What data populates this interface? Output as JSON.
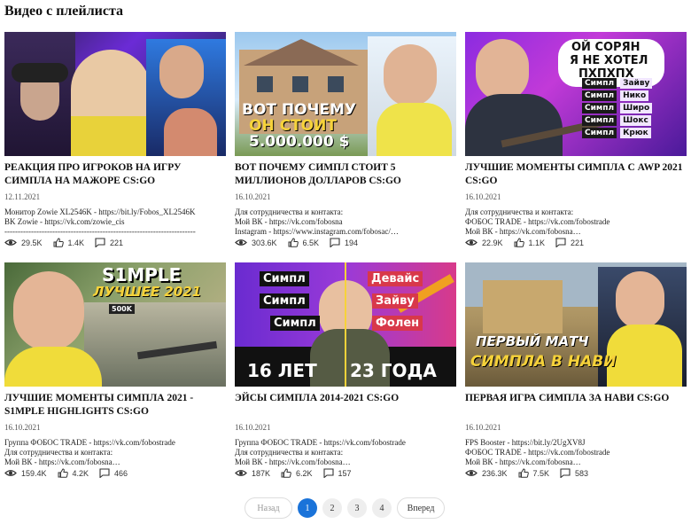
{
  "heading": "Видео с плейлиста",
  "videos": [
    {
      "title": "РЕАКЦИЯ ПРО ИГРОКОВ НА ИГРУ СИМПЛА НА МАЖОРЕ CS:GO",
      "date": "12.11.2021",
      "desc": "Монитор Zowie XL2546K - https://bit.ly/Fobos_XL2546K\nBK Zowie - https://vk.com/zowie_cis\n------------------------------------------------------------------------",
      "views": "29.5K",
      "likes": "1.4K",
      "comments": "221",
      "overlay": []
    },
    {
      "title": "ВОТ ПОЧЕМУ СИМПЛ СТОИТ 5 МИЛЛИОНОВ ДОЛЛАРОВ CS:GO",
      "date": "16.10.2021",
      "desc": "Для сотрудничества и контакта:\nМой ВК - https://vk.com/fobosna\nInstagram - https://www.instagram.com/fobosac/…",
      "views": "303.6K",
      "likes": "6.5K",
      "comments": "194",
      "overlay": [
        "ВОТ ПОЧЕМУ",
        "ОН СТОИТ",
        "5.000.000 $"
      ]
    },
    {
      "title": "ЛУЧШИЕ МОМЕНТЫ СИМПЛА С AWP 2021 CS:GO",
      "date": "16.10.2021",
      "desc": "Для сотрудничества и контакта:\nФОБОС TRADE - https://vk.com/fobostrade\nМой ВК - https://vk.com/fobosna…",
      "views": "22.9K",
      "likes": "1.1K",
      "comments": "221",
      "overlay": [
        "ОЙ СОРЯН",
        "Я НЕ ХОТЕЛ",
        "ПХПХПХ",
        "Симпл",
        "Зайву",
        "Симпл",
        "Нико",
        "Симпл",
        "Широ",
        "Симпл",
        "Шокс",
        "Симпл",
        "Крюк"
      ]
    },
    {
      "title": "ЛУЧШИЕ МОМЕНТЫ СИМПЛА 2021 - S1MPLE HIGHLIGHTS CS:GO",
      "date": "16.10.2021",
      "desc": "Группа ФОБОС TRADE - https://vk.com/fobostrade\nДля сотрудничества и контакта:\nМой ВК - https://vk.com/fobosna…",
      "views": "159.4K",
      "likes": "4.2K",
      "comments": "466",
      "overlay": [
        "S1MPLE",
        "ЛУЧШЕЕ 2021",
        "500K"
      ]
    },
    {
      "title": "ЭЙСЫ СИМПЛА 2014-2021 CS:GO",
      "date": "16.10.2021",
      "desc": "Группа ФОБОС TRADE - https://vk.com/fobostrade\nДля сотрудничества и контакта:\nМой ВК - https://vk.com/fobosna…",
      "views": "187K",
      "likes": "6.2K",
      "comments": "157",
      "overlay": [
        "Симпл",
        "Симпл",
        "Симпл",
        "Девайс",
        "Зайву",
        "Фолен",
        "16 ЛЕТ",
        "23 ГОДА"
      ]
    },
    {
      "title": "ПЕРВАЯ ИГРА СИМПЛА ЗА НАВИ CS:GO",
      "date": "16.10.2021",
      "desc": "FPS Booster - https://bit.ly/2UgXV8J\nФОБОС TRADE - https://vk.com/fobostrade\nМой ВК - https://vk.com/fobosna…",
      "views": "236.3K",
      "likes": "7.5K",
      "comments": "583",
      "overlay": [
        "ПЕРВЫЙ МАТЧ",
        "СИМПЛА В НАВИ"
      ]
    }
  ],
  "pagination": {
    "prev": "Назад",
    "pages": [
      "1",
      "2",
      "3",
      "4"
    ],
    "active_page": "1",
    "next": "Вперед"
  }
}
